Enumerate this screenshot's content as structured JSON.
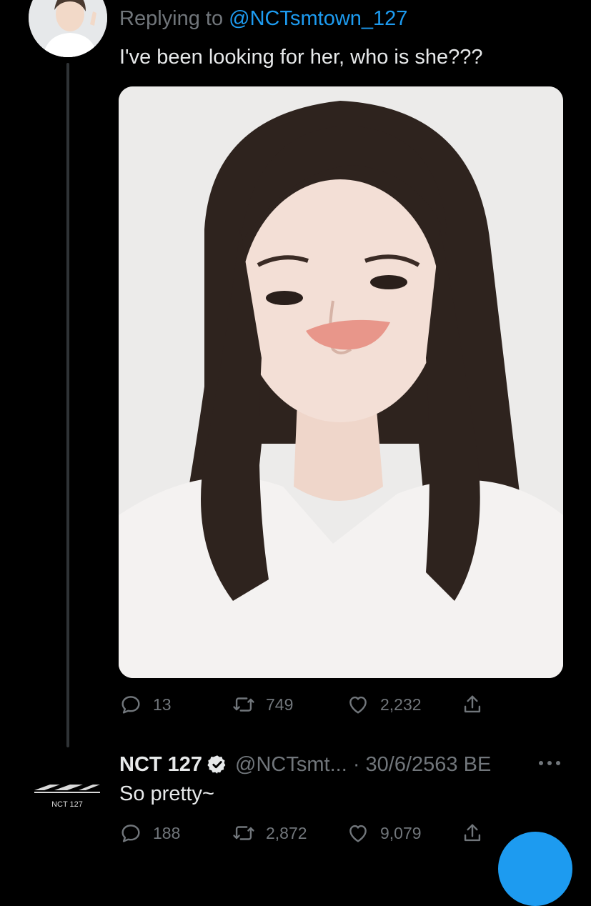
{
  "tweet1": {
    "replying_prefix": "Replying to",
    "replying_handle": "@NCTsmtown_127",
    "text": "I've been looking for her, who is she???",
    "actions": {
      "replies": "13",
      "retweets": "749",
      "likes": "2,232"
    }
  },
  "tweet2": {
    "display_name": "NCT 127",
    "handle_and_date": "@NCTsmt... · 30/6/2563 BE",
    "avatar_caption": "NCT 127",
    "text": "So pretty~",
    "actions": {
      "replies": "188",
      "retweets": "2,872",
      "likes": "9,079"
    }
  },
  "icons": [
    "reply-icon",
    "retweet-icon",
    "like-icon",
    "share-icon",
    "verified-icon",
    "more-icon"
  ],
  "colors": {
    "background": "#000000",
    "text": "#e7e9ea",
    "secondary_text": "#71767b",
    "accent": "#1d9bf0",
    "thread_line": "#2f3336"
  }
}
